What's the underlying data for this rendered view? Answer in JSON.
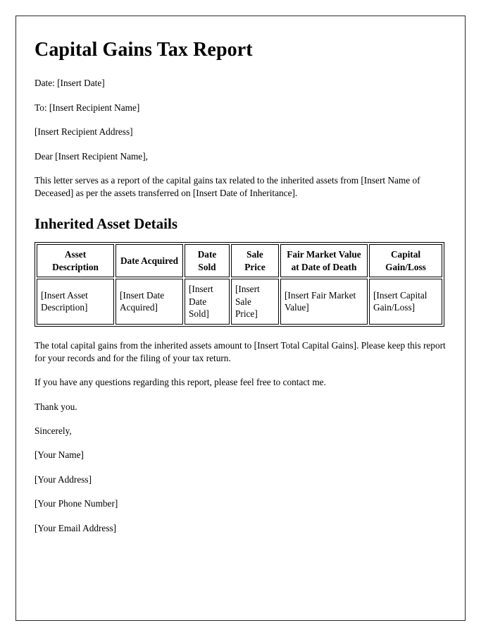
{
  "document": {
    "title": "Capital Gains Tax Report",
    "header_lines": [
      "Date: [Insert Date]",
      "To: [Insert Recipient Name]",
      "[Insert Recipient Address]",
      "Dear [Insert Recipient Name],"
    ],
    "intro_paragraph": "This letter serves as a report of the capital gains tax related to the inherited assets from [Insert Name of Deceased] as per the assets transferred on [Insert Date of Inheritance].",
    "section_title": "Inherited Asset Details",
    "table": {
      "headers": [
        "Asset Description",
        "Date Acquired",
        "Date Sold",
        "Sale Price",
        "Fair Market Value at Date of Death",
        "Capital Gain/Loss"
      ],
      "rows": [
        [
          "[Insert Asset Description]",
          "[Insert Date Acquired]",
          "[Insert Date Sold]",
          "[Insert Sale Price]",
          "[Insert Fair Market Value]",
          "[Insert Capital Gain/Loss]"
        ]
      ]
    },
    "total_paragraph": "The total capital gains from the inherited assets amount to [Insert Total Capital Gains]. Please keep this report for your records and for the filing of your tax return.",
    "questions_paragraph": "If you have any questions regarding this report, please feel free to contact me.",
    "thanks": "Thank you.",
    "closing": "Sincerely,",
    "signature_lines": [
      "[Your Name]",
      "[Your Address]",
      "[Your Phone Number]",
      "[Your Email Address]"
    ]
  },
  "colors": {
    "page_background": "#ffffff",
    "text": "#000000",
    "frame_border": "#2b2b2b",
    "table_border": "#000000"
  }
}
